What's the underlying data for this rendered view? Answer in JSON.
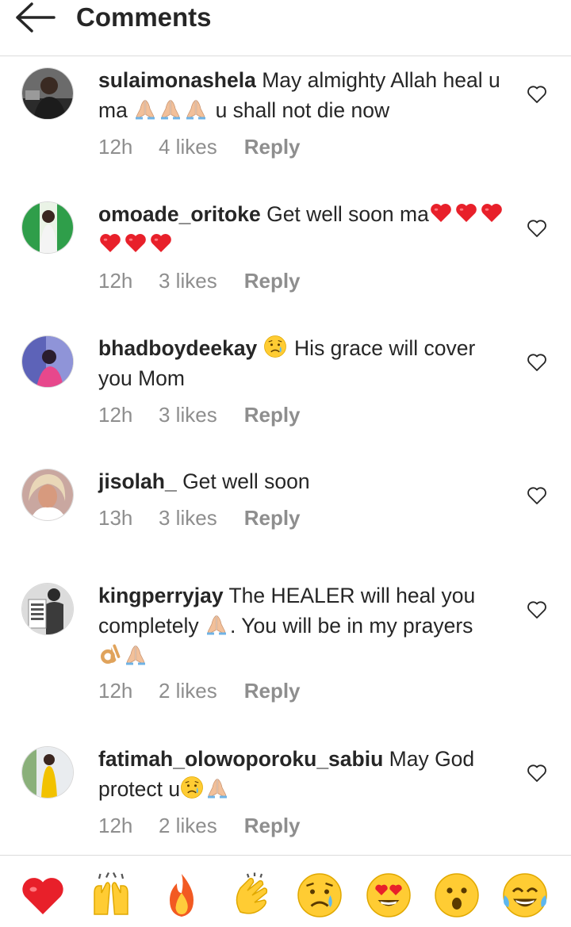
{
  "header": {
    "title": "Comments",
    "back_icon": "arrow-left-icon"
  },
  "comments": [
    {
      "username": "sulaimonashela",
      "text_a": "May almighty Allah heal u ma",
      "text_b": "u shall not die now",
      "emojis": [
        "folded-hands-icon",
        "folded-hands-icon",
        "folded-hands-icon"
      ],
      "time": "12h",
      "likes": "4 likes",
      "reply": "Reply"
    },
    {
      "username": "omoade_oritoke",
      "text_a": "Get well soon ma",
      "emojis": [
        "red-heart-icon",
        "red-heart-icon",
        "red-heart-icon",
        "red-heart-icon",
        "red-heart-icon",
        "red-heart-icon"
      ],
      "time": "12h",
      "likes": "3 likes",
      "reply": "Reply"
    },
    {
      "username": "bhadboydeekay",
      "text_a": "His grace will cover you Mom",
      "emojis": [
        "sad-relieved-face-icon"
      ],
      "time": "12h",
      "likes": "3 likes",
      "reply": "Reply"
    },
    {
      "username": "jisolah_",
      "text_a": "Get well soon",
      "time": "13h",
      "likes": "3 likes",
      "reply": "Reply"
    },
    {
      "username": "kingperryjay",
      "text_a": "The HEALER will heal you completely",
      "text_b": ". You will be in my prayers",
      "emojis": [
        "folded-hands-icon",
        "ok-hand-icon",
        "folded-hands-icon"
      ],
      "time": "12h",
      "likes": "2 likes",
      "reply": "Reply"
    },
    {
      "username": "fatimah_olowoporoku_sabiu",
      "text_a": "May God protect u",
      "emojis": [
        "sad-relieved-face-icon",
        "folded-hands-icon"
      ],
      "time": "12h",
      "likes": "2 likes",
      "reply": "Reply"
    }
  ],
  "reactions": [
    "red-heart-icon",
    "raising-hands-icon",
    "fire-icon",
    "clapping-hands-icon",
    "sad-relieved-face-icon",
    "heart-eyes-face-icon",
    "astonished-face-icon",
    "tears-of-joy-face-icon"
  ],
  "colors": {
    "text": "#262626",
    "meta": "#8e8e8e",
    "divider": "#dbdbdb",
    "heart": "#ed1c24"
  }
}
